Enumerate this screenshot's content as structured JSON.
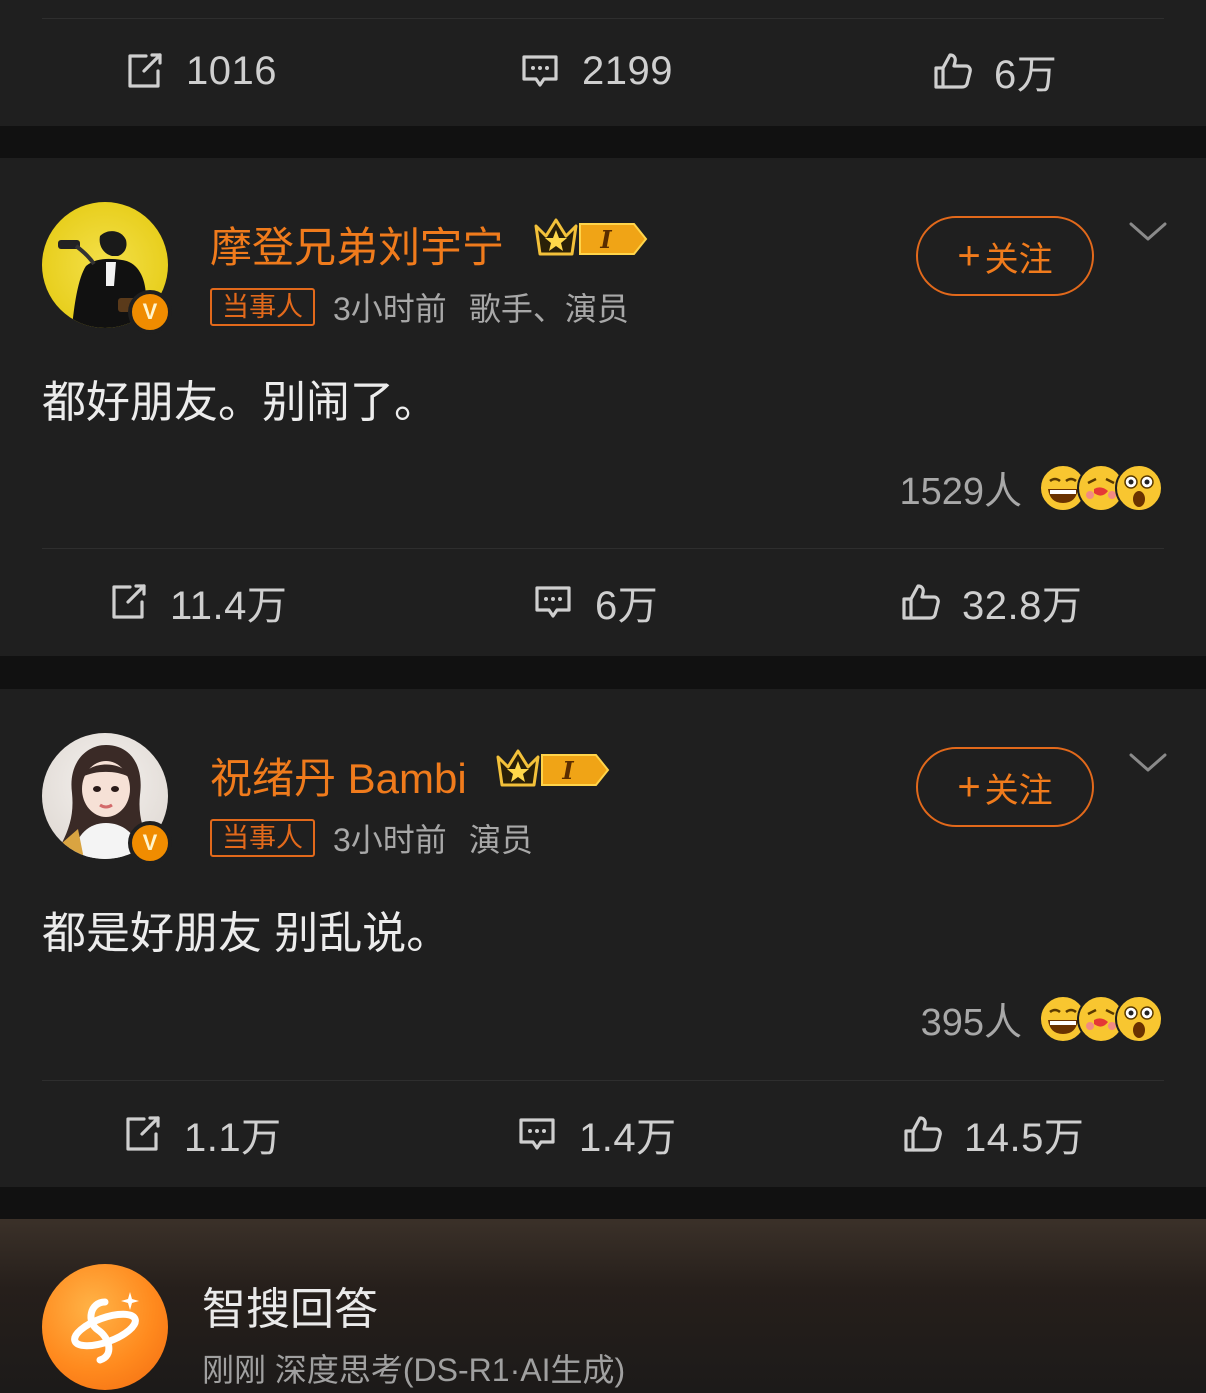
{
  "top_actions": {
    "repost": "1016",
    "comment": "2199",
    "like": "6万"
  },
  "posts": [
    {
      "username": "摩登兄弟刘宇宁",
      "tag": "当事人",
      "time": "3小时前",
      "role": "歌手、演员",
      "follow_label": "关注",
      "content": "都好朋友。别闹了。",
      "reaction_count": "1529人",
      "repost": "11.4万",
      "comment": "6万",
      "like": "32.8万"
    },
    {
      "username": "祝绪丹 Bambi",
      "tag": "当事人",
      "time": "3小时前",
      "role": "演员",
      "follow_label": "关注",
      "content": "都是好朋友 别乱说。",
      "reaction_count": "395人",
      "repost": "1.1万",
      "comment": "1.4万",
      "like": "14.5万"
    }
  ],
  "ai_answer": {
    "title": "智搜回答",
    "subtitle": "刚刚  深度思考(DS-R1·AI生成)"
  },
  "colors": {
    "accent": "#f07b1c",
    "background": "#111111",
    "card": "#1f1f1f",
    "vip_orange": "#f08c00"
  },
  "icons": [
    "repost-icon",
    "comment-icon",
    "like-icon",
    "verified-icon",
    "crown-icon",
    "chevron-down-icon",
    "ai-search-icon"
  ]
}
